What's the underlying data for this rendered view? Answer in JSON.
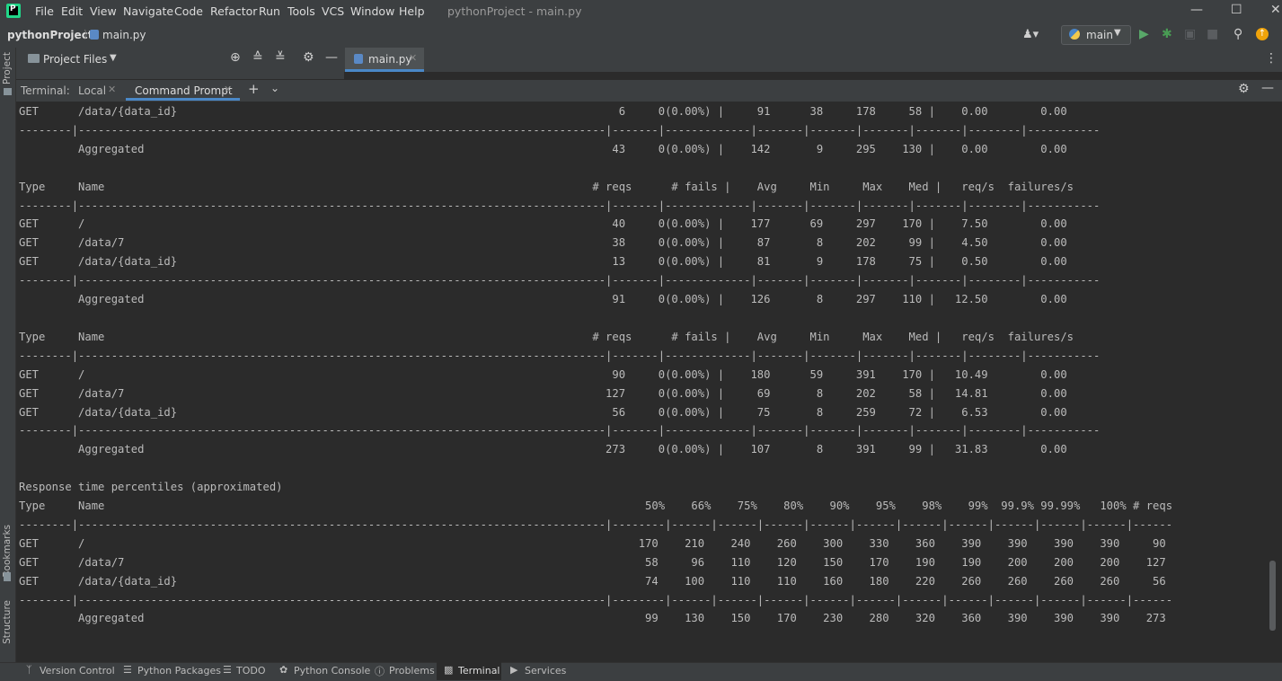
{
  "menubar": {
    "items": [
      "File",
      "Edit",
      "View",
      "Navigate",
      "Code",
      "Refactor",
      "Run",
      "Tools",
      "VCS",
      "Window",
      "Help"
    ],
    "window_title": "pythonProject - main.py"
  },
  "navbar": {
    "project": "pythonProject",
    "file": "main.py",
    "branch": "main"
  },
  "project_panel": {
    "title": "Project Files"
  },
  "editor": {
    "tab_label": "main.py"
  },
  "left_stripe": {
    "project": "Project",
    "bookmarks": "Bookmarks",
    "structure": "Structure"
  },
  "terminal": {
    "label": "Terminal:",
    "tabs": [
      "Local",
      "Command Prompt"
    ],
    "output": "GET      /data/{data_id}                                                                   6     0(0.00%) |     91      38     178     58 |    0.00        0.00\n--------|--------------------------------------------------------------------------------|-------|-------------|-------|-------|-------|-------|--------|-----------\n         Aggregated                                                                       43     0(0.00%) |    142       9     295    130 |    0.00        0.00\n\nType     Name                                                                          # reqs      # fails |    Avg     Min     Max    Med |   req/s  failures/s\n--------|--------------------------------------------------------------------------------|-------|-------------|-------|-------|-------|-------|--------|-----------\nGET      /                                                                                40     0(0.00%) |    177      69     297    170 |    7.50        0.00\nGET      /data/7                                                                          38     0(0.00%) |     87       8     202     99 |    4.50        0.00\nGET      /data/{data_id}                                                                  13     0(0.00%) |     81       9     178     75 |    0.50        0.00\n--------|--------------------------------------------------------------------------------|-------|-------------|-------|-------|-------|-------|--------|-----------\n         Aggregated                                                                       91     0(0.00%) |    126       8     297    110 |   12.50        0.00\n\nType     Name                                                                          # reqs      # fails |    Avg     Min     Max    Med |   req/s  failures/s\n--------|--------------------------------------------------------------------------------|-------|-------------|-------|-------|-------|-------|--------|-----------\nGET      /                                                                                90     0(0.00%) |    180      59     391    170 |   10.49        0.00\nGET      /data/7                                                                         127     0(0.00%) |     69       8     202     58 |   14.81        0.00\nGET      /data/{data_id}                                                                  56     0(0.00%) |     75       8     259     72 |    6.53        0.00\n--------|--------------------------------------------------------------------------------|-------|-------------|-------|-------|-------|-------|--------|-----------\n         Aggregated                                                                      273     0(0.00%) |    107       8     391     99 |   31.83        0.00\n\nResponse time percentiles (approximated)\nType     Name                                                                                  50%    66%    75%    80%    90%    95%    98%    99%  99.9% 99.99%   100% # reqs\n--------|--------------------------------------------------------------------------------|--------|------|------|------|------|------|------|------|------|------|------|------\nGET      /                                                                                    170    210    240    260    300    330    360    390    390    390    390     90\nGET      /data/7                                                                               58     96    110    120    150    170    190    190    200    200    200    127\nGET      /data/{data_id}                                                                       74    100    110    110    160    180    220    260    260    260    260     56\n--------|--------------------------------------------------------------------------------|--------|------|------|------|------|------|------|------|------|------|------|------\n         Aggregated                                                                            99    130    150    170    230    280    320    360    390    390    390    273"
  },
  "statusbar": {
    "items": [
      "Version Control",
      "Python Packages",
      "TODO",
      "Python Console",
      "Problems",
      "Terminal",
      "Services"
    ]
  },
  "colors": {
    "accent": "#4a88c7",
    "panel": "#3c3f41",
    "background": "#2b2b2b",
    "run": "#59a869",
    "debug": "#499c54",
    "update": "#f0a30a"
  }
}
